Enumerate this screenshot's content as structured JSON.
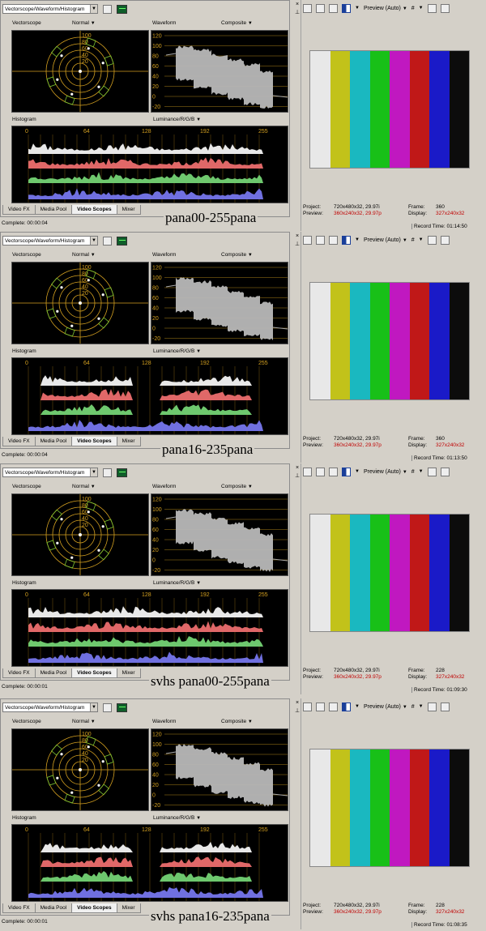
{
  "common": {
    "scope_select_value": "Vectorscope/Waveform/Histogram",
    "vectorscope_label": "Vectorscope",
    "vectorscope_mode": "Normal",
    "waveform_label": "Waveform",
    "waveform_mode": "Composite",
    "histogram_label": "Histogram",
    "histogram_mode": "Luminance/R/G/B",
    "wf_ticks": [
      "120",
      "100",
      "80",
      "60",
      "40",
      "20",
      "0",
      "-20"
    ],
    "vs_ticks": [
      "100",
      "80",
      "60",
      "40",
      "20"
    ],
    "hist_ticks": [
      "0",
      "64",
      "128",
      "192",
      "255"
    ],
    "tabs": [
      "Video FX",
      "Media Pool",
      "Video Scopes",
      "Mixer"
    ],
    "active_tab": "Video Scopes",
    "preview_label": "Preview (Auto)",
    "info_project_label": "Project:",
    "info_preview_label": "Preview:",
    "info_frame_label": "Frame:",
    "info_display_label": "Display:",
    "info_project_value": "720x480x32, 29.97i",
    "info_display_value": "327x240x32",
    "record_time_label": "Record Time:",
    "colors": {
      "bars": [
        "#e8e8e8",
        "#c2c21a",
        "#1ab8c0",
        "#18c018",
        "#c018c0",
        "#c01818",
        "#1a1ac8",
        "#0c0c0c"
      ],
      "lum": "#e8e8e8",
      "red": "#e06868",
      "green": "#6ec86e",
      "blue": "#7070e0",
      "grat": "#d4a020"
    }
  },
  "sections": [
    {
      "caption": "pana00-255pana",
      "complete": "Complete: 00:00:04",
      "preview_value": "360x240x32, 29.97p",
      "frame": "360",
      "record_time": "01:14:50"
    },
    {
      "caption": "pana16-235pana",
      "complete": "Complete: 00:00:04",
      "preview_value": "360x240x32, 29.97p",
      "frame": "360",
      "record_time": "01:13:50"
    },
    {
      "caption": "svhs pana00-255pana",
      "complete": "Complete: 00:00:01",
      "preview_value": "360x240x32, 29.97p",
      "frame": "228",
      "record_time": "01:09:30"
    },
    {
      "caption": "svhs pana16-235pana",
      "complete": "Complete: 00:00:01",
      "preview_value": "360x240x32, 29.97p",
      "frame": "228",
      "record_time": "01:08:35"
    }
  ]
}
